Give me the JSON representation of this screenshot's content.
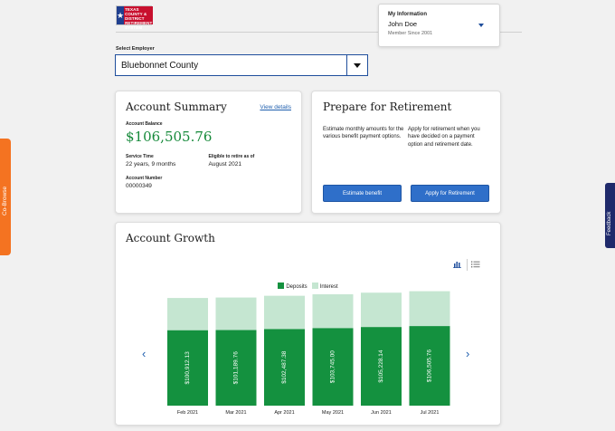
{
  "header": {
    "logo_text": "TEXAS COUNTY & DISTRICT RETIREMENT SYSTEM",
    "my_info": {
      "label": "My Information",
      "name": "John Doe",
      "since": "Member Since 2001"
    }
  },
  "employer": {
    "label": "Select Employer",
    "value": "Bluebonnet County"
  },
  "summary": {
    "title": "Account Summary",
    "view_details": "View details",
    "balance_label": "Account Balance",
    "balance": "$106,505.76",
    "service_label": "Service Time",
    "service": "22 years, 9 months",
    "eligible_label": "Eligible to retire as of",
    "eligible": "August 2021",
    "number_label": "Account Number",
    "number": "00000349"
  },
  "prepare": {
    "title": "Prepare for Retirement",
    "left_text": "Estimate monthly amounts for the various benefit payment options.",
    "right_text": "Apply for retirement when you have decided on a payment option and retirement date.",
    "estimate_button": "Estimate benefit",
    "apply_button": "Apply for Retirement"
  },
  "growth": {
    "title": "Account Growth",
    "icons": {
      "chart_view": "bar-chart-icon",
      "list_view": "list-icon",
      "prev": "chevron-left-icon",
      "next": "chevron-right-icon"
    },
    "colors": {
      "deposits": "#14913f",
      "interest": "#c5e6d1"
    }
  },
  "chart_data": {
    "type": "bar",
    "stacked": true,
    "categories": [
      "Feb 2021",
      "Mar 2021",
      "Apr 2021",
      "May 2021",
      "Jun 2021",
      "Jul 2021"
    ],
    "series": [
      {
        "name": "Deposits",
        "values": [
          100912.13,
          101189.76,
          102487.38,
          103745.0,
          105228.14,
          106505.76
        ],
        "labels": [
          "$100,912.13",
          "$101,189.76",
          "$102,487.38",
          "$103,745.00",
          "$105,228.14",
          "$106,505.76"
        ]
      },
      {
        "name": "Interest",
        "values": [
          62000,
          62500,
          64000,
          65000,
          66000,
          67000
        ]
      }
    ],
    "legend": "top-center"
  },
  "side": {
    "cobrowse": "Co-Browse",
    "feedback": "Feedback"
  }
}
